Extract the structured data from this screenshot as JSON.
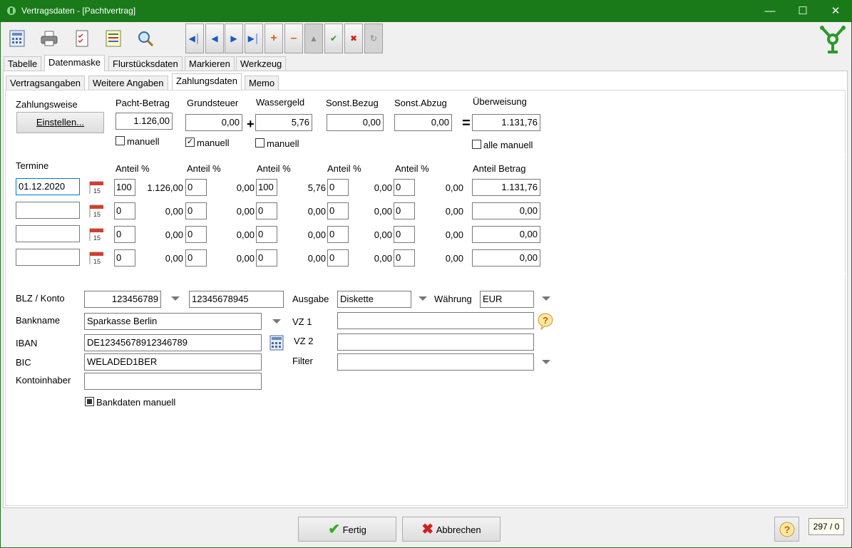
{
  "window": {
    "title": "Vertragsdaten - [Pachtvertrag]"
  },
  "main_tabs": [
    "Tabelle",
    "Datenmaske",
    "Flurstücksdaten",
    "Markieren",
    "Werkzeug"
  ],
  "sub_tabs": [
    "Vertragsangaben",
    "Weitere Angaben",
    "Zahlungsdaten",
    "Memo"
  ],
  "payment": {
    "zahlungsweise_label": "Zahlungsweise",
    "einstellen_button": "Einstellen...",
    "pacht_label": "Pacht-Betrag",
    "pacht_value": "1.126,00",
    "grundsteuer_label": "Grundsteuer",
    "grundsteuer_value": "0,00",
    "wassergeld_label": "Wassergeld",
    "wassergeld_value": "5,76",
    "sonst_bezug_label": "Sonst.Bezug",
    "sonst_bezug_value": "0,00",
    "sonst_abzug_label": "Sonst.Abzug",
    "sonst_abzug_value": "0,00",
    "ueberweisung_label": "Überweisung",
    "ueberweisung_value": "1.131,76",
    "plus": "+",
    "equals": "=",
    "manuell": "manuell",
    "alle_manuell": "alle manuell"
  },
  "termine": {
    "label": "Termine",
    "anteil_label": "Anteil %",
    "anteil_betrag_label": "Anteil Betrag",
    "rows": [
      {
        "date": "01.12.2020",
        "p1": "100",
        "v1": "1.126,00",
        "p2": "0",
        "v2": "0,00",
        "p3": "100",
        "v3": "5,76",
        "p4": "0",
        "v4": "0,00",
        "p5": "0",
        "v5": "0,00",
        "betrag": "1.131,76"
      },
      {
        "date": "",
        "p1": "0",
        "v1": "0,00",
        "p2": "0",
        "v2": "0,00",
        "p3": "0",
        "v3": "0,00",
        "p4": "0",
        "v4": "0,00",
        "p5": "0",
        "v5": "0,00",
        "betrag": "0,00"
      },
      {
        "date": "",
        "p1": "0",
        "v1": "0,00",
        "p2": "0",
        "v2": "0,00",
        "p3": "0",
        "v3": "0,00",
        "p4": "0",
        "v4": "0,00",
        "p5": "0",
        "v5": "0,00",
        "betrag": "0,00"
      },
      {
        "date": "",
        "p1": "0",
        "v1": "0,00",
        "p2": "0",
        "v2": "0,00",
        "p3": "0",
        "v3": "0,00",
        "p4": "0",
        "v4": "0,00",
        "p5": "0",
        "v5": "0,00",
        "betrag": "0,00"
      }
    ]
  },
  "bank": {
    "blz_label": "BLZ / Konto",
    "blz_value": "123456789",
    "konto_value": "12345678945",
    "bankname_label": "Bankname",
    "bankname_value": "Sparkasse Berlin",
    "iban_label": "IBAN",
    "iban_value": "DE12345678912346789",
    "bic_label": "BIC",
    "bic_value": "WELADED1BER",
    "kontoinhaber_label": "Kontoinhaber",
    "kontoinhaber_value": "",
    "bankdaten_manuell": "Bankdaten manuell",
    "ausgabe_label": "Ausgabe",
    "ausgabe_value": "Diskette",
    "waehrung_label": "Währung",
    "waehrung_value": "EUR",
    "vz1_label": "VZ 1",
    "vz1_value": "",
    "vz2_label": "VZ 2",
    "vz2_value": "",
    "filter_label": "Filter",
    "filter_value": ""
  },
  "footer": {
    "fertig": "Fertig",
    "abbrechen": "Abbrechen",
    "record_counter": "297 / 0"
  },
  "colors": {
    "titlebar": "#1a7a1a",
    "accent_green": "#2a9a2a"
  }
}
